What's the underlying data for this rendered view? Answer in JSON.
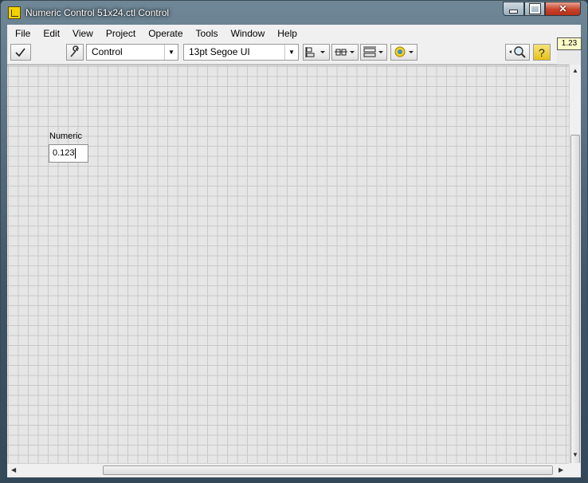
{
  "window": {
    "title": "Numeric Control 51x24.ctl Control"
  },
  "menu": [
    "File",
    "Edit",
    "View",
    "Project",
    "Operate",
    "Tools",
    "Window",
    "Help"
  ],
  "toolbar": {
    "mode_select": "Control",
    "font_select": "13pt Segoe UI"
  },
  "indicator": "1.23",
  "panel": {
    "numeric_label": "Numeric",
    "numeric_value": "0.123"
  }
}
